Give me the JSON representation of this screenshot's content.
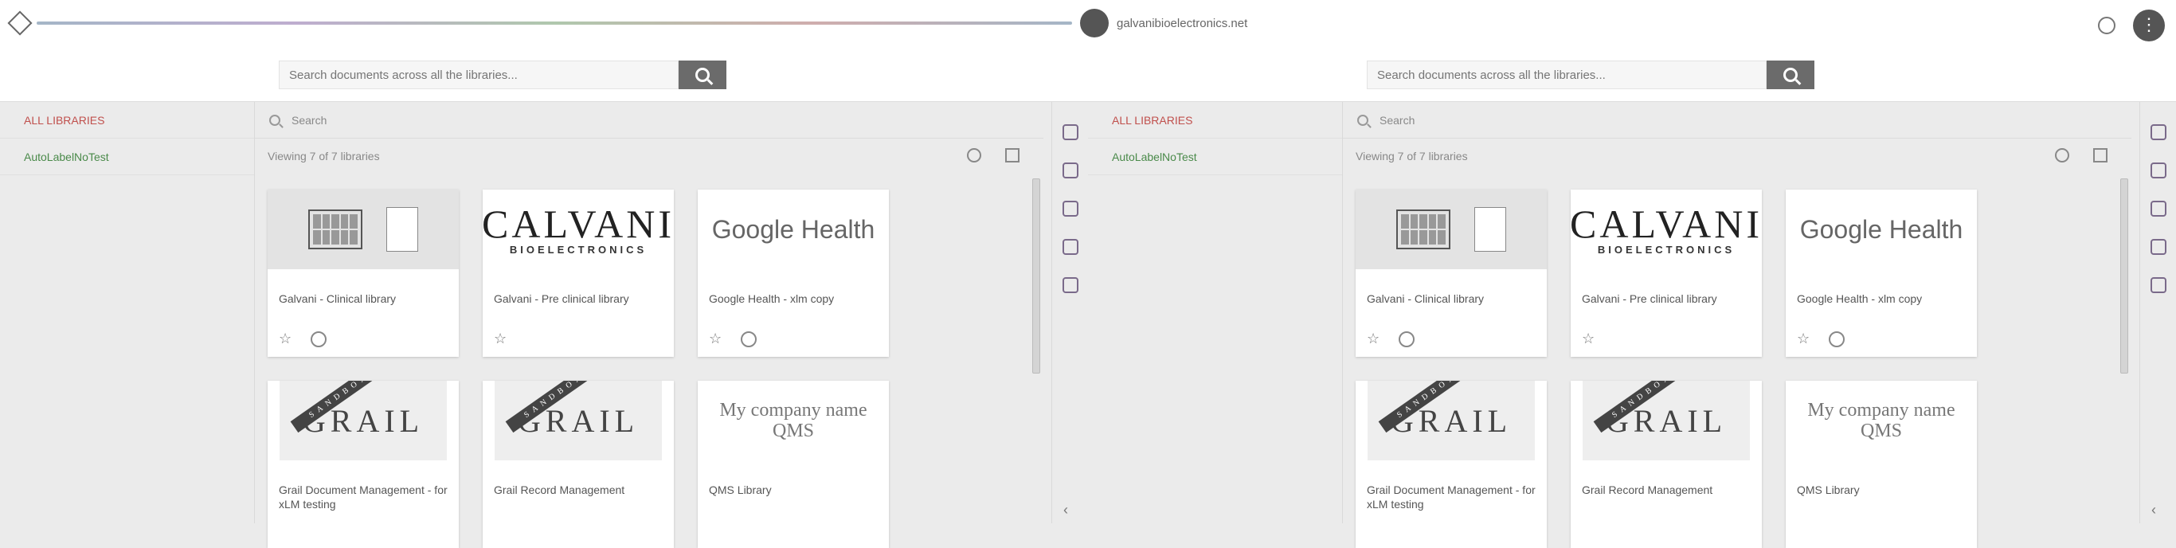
{
  "header": {
    "site": "galvanibioelectronics.net"
  },
  "panes": [
    {
      "search": {
        "placeholder": "Search documents across all the libraries..."
      },
      "sidebar": {
        "items": [
          {
            "label": "ALL LIBRARIES"
          },
          {
            "label": "AutoLabelNoTest"
          }
        ]
      },
      "filter": {
        "placeholder": "Search"
      },
      "count": "Viewing 7 of 7 libraries",
      "cards": [
        {
          "title": "Galvani - Clinical library",
          "thumb": "calendar"
        },
        {
          "title": "Galvani - Pre clinical library",
          "thumb": "calvani",
          "logo": "CALVANI",
          "logo_sub": "BIOELECTRONICS"
        },
        {
          "title": "Google Health - xlm copy",
          "thumb": "google",
          "logo": "Google Health"
        },
        {
          "title": "Grail Document Management - for xLM testing",
          "thumb": "grail",
          "logo": "GRAIL",
          "ribbon": "SANDBOX"
        },
        {
          "title": "Grail Record Management",
          "thumb": "grail",
          "logo": "GRAIL",
          "ribbon": "SANDBOX"
        },
        {
          "title": "QMS Library",
          "thumb": "qms",
          "logo": "My company name QMS"
        }
      ]
    },
    {
      "search": {
        "placeholder": "Search documents across all the libraries..."
      },
      "sidebar": {
        "items": [
          {
            "label": "ALL LIBRARIES"
          },
          {
            "label": "AutoLabelNoTest"
          }
        ]
      },
      "filter": {
        "placeholder": "Search"
      },
      "count": "Viewing 7 of 7 libraries",
      "cards": [
        {
          "title": "Galvani - Clinical library",
          "thumb": "calendar"
        },
        {
          "title": "Galvani - Pre clinical library",
          "thumb": "calvani",
          "logo": "CALVANI",
          "logo_sub": "BIOELECTRONICS"
        },
        {
          "title": "Google Health - xlm copy",
          "thumb": "google",
          "logo": "Google Health"
        },
        {
          "title": "Grail Document Management - for xLM testing",
          "thumb": "grail",
          "logo": "GRAIL",
          "ribbon": "SANDBOX"
        },
        {
          "title": "Grail Record Management",
          "thumb": "grail",
          "logo": "GRAIL",
          "ribbon": "SANDBOX"
        },
        {
          "title": "QMS Library",
          "thumb": "qms",
          "logo": "My company name QMS"
        }
      ]
    }
  ]
}
